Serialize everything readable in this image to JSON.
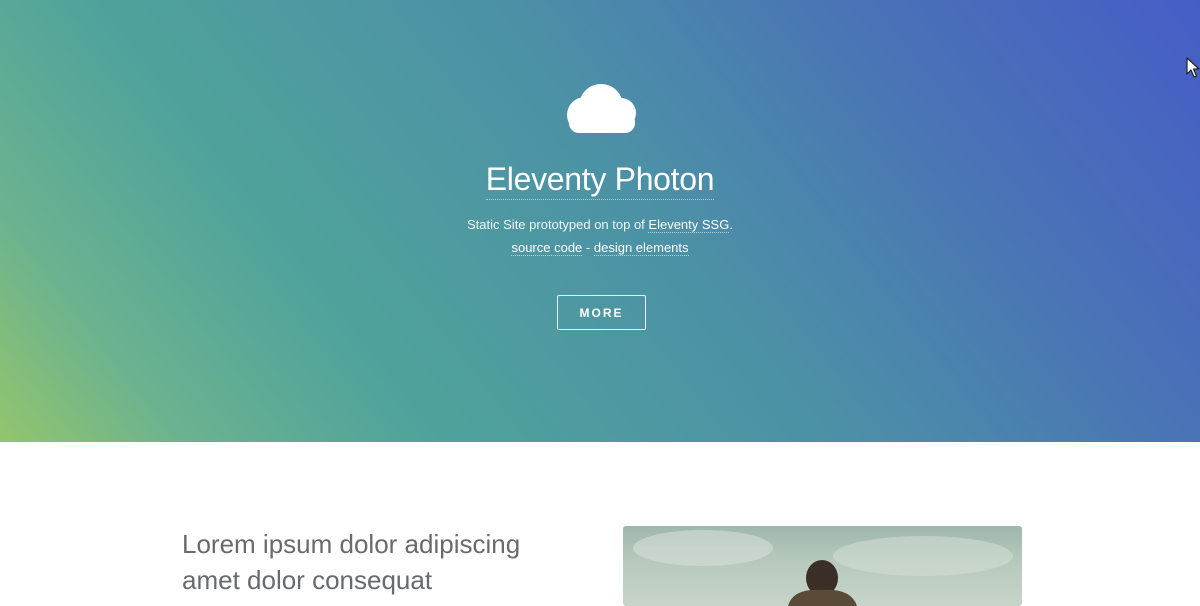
{
  "header": {
    "title": "Eleventy Photon",
    "subtitle_prefix": "Static Site prototyped on top of ",
    "subtitle_link": "Eleventy SSG",
    "subtitle_suffix": ".",
    "source_code_link": "source code",
    "separator": " - ",
    "design_elements_link": "design elements",
    "more_button": "MORE",
    "icon": "cloud-icon",
    "gradient_colors": [
      "#93c56d",
      "#4fa39b",
      "#4a72b6",
      "#465dc6"
    ]
  },
  "section": {
    "heading_line1": "Lorem ipsum dolor adipiscing",
    "heading_line2": "amet dolor consequat"
  }
}
